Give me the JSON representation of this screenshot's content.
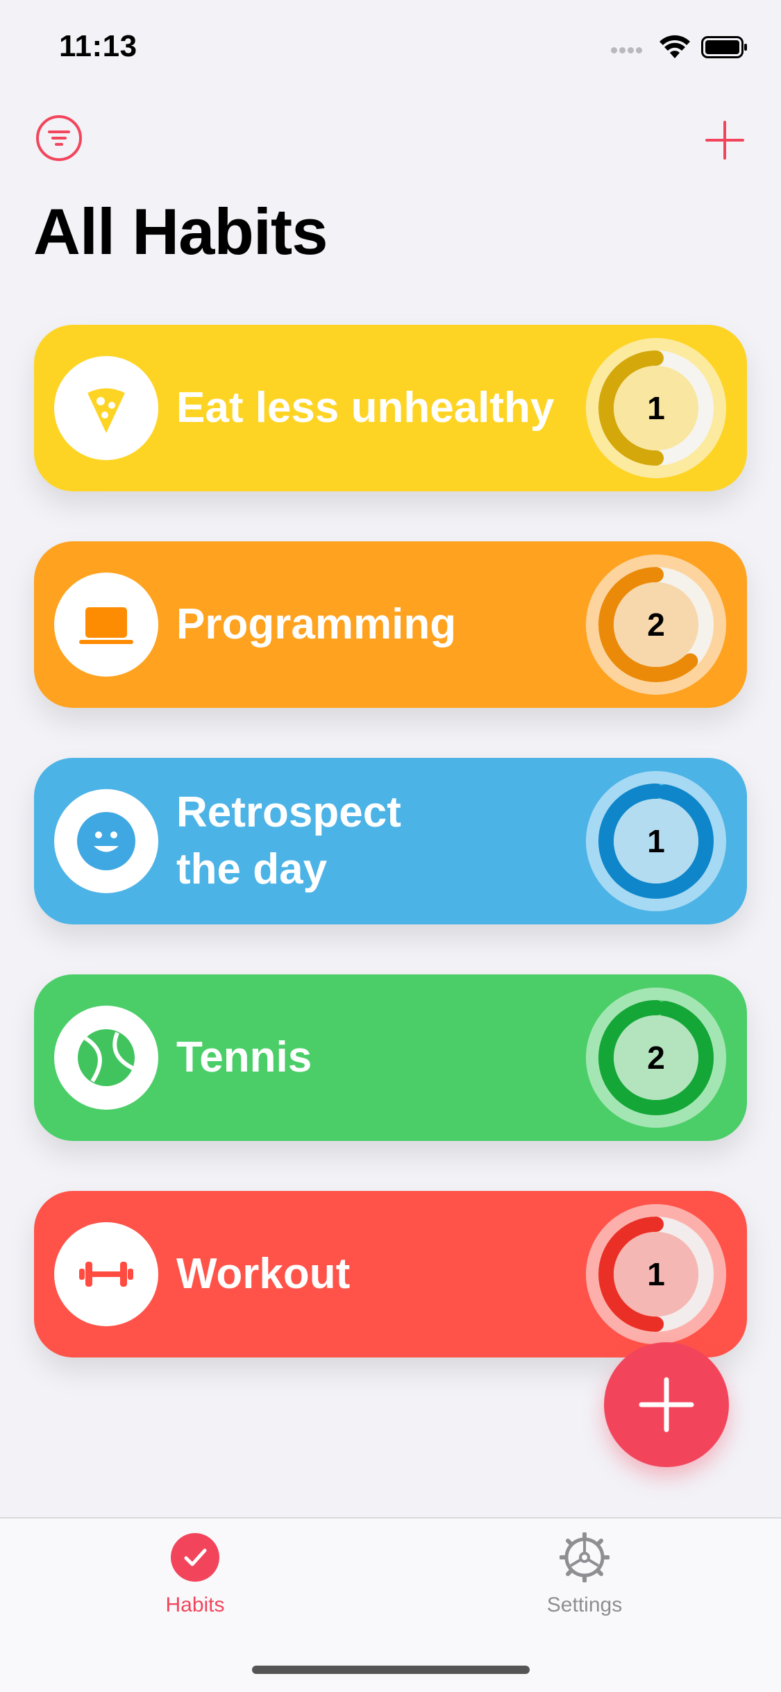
{
  "status_bar": {
    "time": "11:13"
  },
  "header": {
    "title": "All Habits"
  },
  "colors": {
    "accent": "#f2455c",
    "eat": "#fed424",
    "programming": "#fea21f",
    "retrospect": "#4cb3e6",
    "tennis": "#4bce68",
    "workout": "#ff5349"
  },
  "habits": [
    {
      "name": "Eat less unhealthy",
      "count": "1",
      "icon": "pizza-icon",
      "progress": 0.5
    },
    {
      "name": "Programming",
      "count": "2",
      "icon": "laptop-icon",
      "progress": 0.62
    },
    {
      "name": "Retrospect the day",
      "count": "1",
      "icon": "smiley-icon",
      "progress": 0.97
    },
    {
      "name": "Tennis",
      "count": "2",
      "icon": "tennis-ball-icon",
      "progress": 0.97
    },
    {
      "name": "Workout",
      "count": "1",
      "icon": "dumbbell-icon",
      "progress": 0.5
    }
  ],
  "tabs": [
    {
      "label": "Habits",
      "icon": "checkmark-circle-icon",
      "active": true
    },
    {
      "label": "Settings",
      "icon": "gear-icon",
      "active": false
    }
  ]
}
